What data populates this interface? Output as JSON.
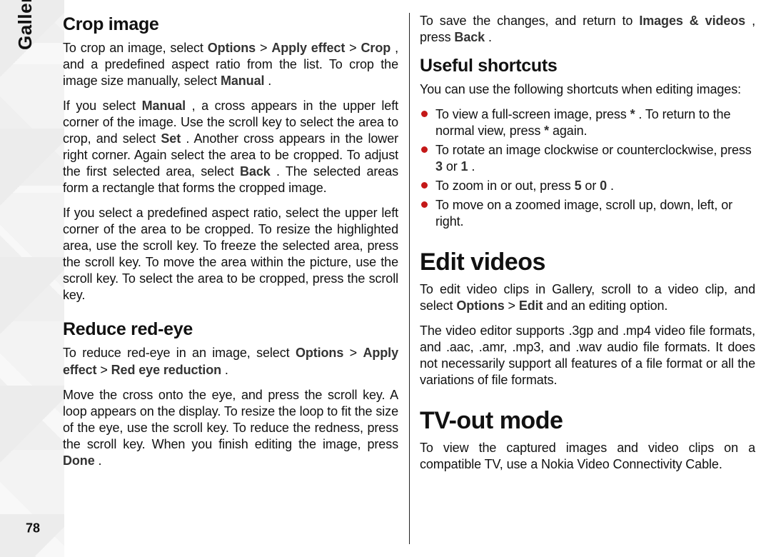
{
  "sidebar": {
    "section_label": "Gallery",
    "page_number": "78"
  },
  "left_column": {
    "crop": {
      "heading": "Crop image",
      "p1_a": "To crop an image, select ",
      "p1_b": "Options",
      "p1_c": " > ",
      "p1_d": "Apply effect",
      "p1_e": " > ",
      "p1_f": "Crop",
      "p1_g": ", and a predefined aspect ratio from the list. To crop the image size manually, select ",
      "p1_h": "Manual",
      "p1_i": ".",
      "p2_a": "If you select ",
      "p2_b": "Manual",
      "p2_c": ", a cross appears in the upper left corner of the image. Use the scroll key to select the area to crop, and select ",
      "p2_d": "Set",
      "p2_e": ". Another cross appears in the lower right corner. Again select the area to be cropped. To adjust the first selected area, select ",
      "p2_f": "Back",
      "p2_g": ". The selected areas form a rectangle that forms the cropped image.",
      "p3": "If you select a predefined aspect ratio, select the upper left corner of the area to be cropped. To resize the highlighted area, use the scroll key. To freeze the selected area, press the scroll key. To move the area within the picture, use the scroll key. To select the area to be cropped, press the scroll key."
    },
    "redeye": {
      "heading": "Reduce red-eye",
      "p1_a": "To reduce red-eye in an image, select ",
      "p1_b": "Options",
      "p1_c": " > ",
      "p1_d": "Apply effect",
      "p1_e": " > ",
      "p1_f": "Red eye reduction",
      "p1_g": ".",
      "p2_a": "Move the cross onto the eye, and press the scroll key. A loop appears on the display. To resize the loop to fit the size of the eye, use the scroll key. To reduce the redness, press the scroll key. When you finish editing the image, press ",
      "p2_b": "Done",
      "p2_c": "."
    }
  },
  "right_column": {
    "save": {
      "p_a": "To save the changes, and return to ",
      "p_b": "Images & videos",
      "p_c": ", press ",
      "p_d": "Back",
      "p_e": "."
    },
    "shortcuts": {
      "heading": "Useful shortcuts",
      "intro": "You can use the following shortcuts when editing images:",
      "items": {
        "0": {
          "a": "To view a full-screen image, press ",
          "b": "*",
          "c": ". To return to the normal view, press ",
          "d": "*",
          "e": " again."
        },
        "1": {
          "a": "To rotate an image clockwise or counterclockwise, press ",
          "b": "3",
          "c": " or ",
          "d": "1",
          "e": "."
        },
        "2": {
          "a": "To zoom in or out, press ",
          "b": "5",
          "c": " or ",
          "d": "0",
          "e": "."
        },
        "3": {
          "a": "To move on a zoomed image, scroll up, down, left, or right."
        }
      }
    },
    "edit_videos": {
      "heading": "Edit videos",
      "p1_a": "To edit video clips in Gallery, scroll to a video clip, and select ",
      "p1_b": "Options",
      "p1_c": " > ",
      "p1_d": "Edit",
      "p1_e": " and an editing option.",
      "p2": "The video editor supports .3gp and .mp4 video file formats, and .aac, .amr, .mp3, and .wav audio file formats. It does not necessarily support all features of a file format or all the variations of file formats."
    },
    "tv_out": {
      "heading": "TV-out mode",
      "p1": "To view the captured images and video clips on a compatible TV, use a Nokia Video Connectivity Cable."
    }
  }
}
